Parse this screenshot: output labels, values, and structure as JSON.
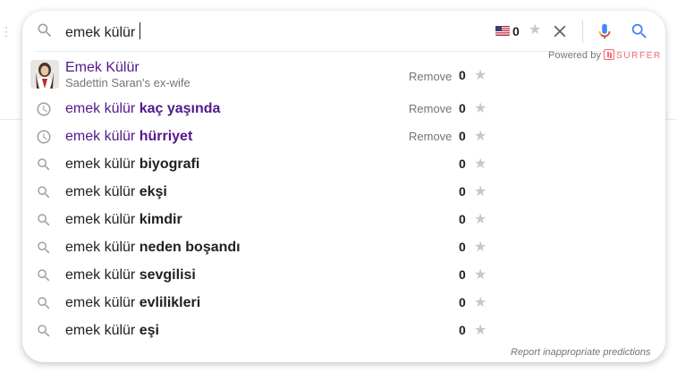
{
  "search": {
    "query": "emek külür",
    "region_count": "0",
    "flag_name": "us-flag-icon"
  },
  "surfer": {
    "powered_label": "Powered by",
    "brand": "SURFER"
  },
  "entity": {
    "title": "Emek Külür",
    "subtitle": "Sadettin Saran's ex-wife",
    "remove_label": "Remove",
    "count": "0"
  },
  "suggestions": [
    {
      "type": "history",
      "base": "emek külür ",
      "bold": "kaç yaşında",
      "remove_label": "Remove",
      "count": "0"
    },
    {
      "type": "history",
      "base": "emek külür ",
      "bold": "hürriyet",
      "remove_label": "Remove",
      "count": "0"
    },
    {
      "type": "search",
      "base": "emek külür ",
      "bold": "biyografi",
      "remove_label": "",
      "count": "0"
    },
    {
      "type": "search",
      "base": "emek külür ",
      "bold": "ekşi",
      "remove_label": "",
      "count": "0"
    },
    {
      "type": "search",
      "base": "emek külür ",
      "bold": "kimdir",
      "remove_label": "",
      "count": "0"
    },
    {
      "type": "search",
      "base": "emek külür ",
      "bold": "neden boşandı",
      "remove_label": "",
      "count": "0"
    },
    {
      "type": "search",
      "base": "emek külür ",
      "bold": "sevgilisi",
      "remove_label": "",
      "count": "0"
    },
    {
      "type": "search",
      "base": "emek külür ",
      "bold": "evlilikleri",
      "remove_label": "",
      "count": "0"
    },
    {
      "type": "search",
      "base": "emek külür ",
      "bold": "eşi",
      "remove_label": "",
      "count": "0"
    }
  ],
  "footer": {
    "report_link": "Report inappropriate predictions"
  },
  "colors": {
    "history_text": "#52188c",
    "mic_blue": "#4285f4",
    "mic_red": "#ea4335",
    "surfer_accent": "#f26a6a"
  }
}
